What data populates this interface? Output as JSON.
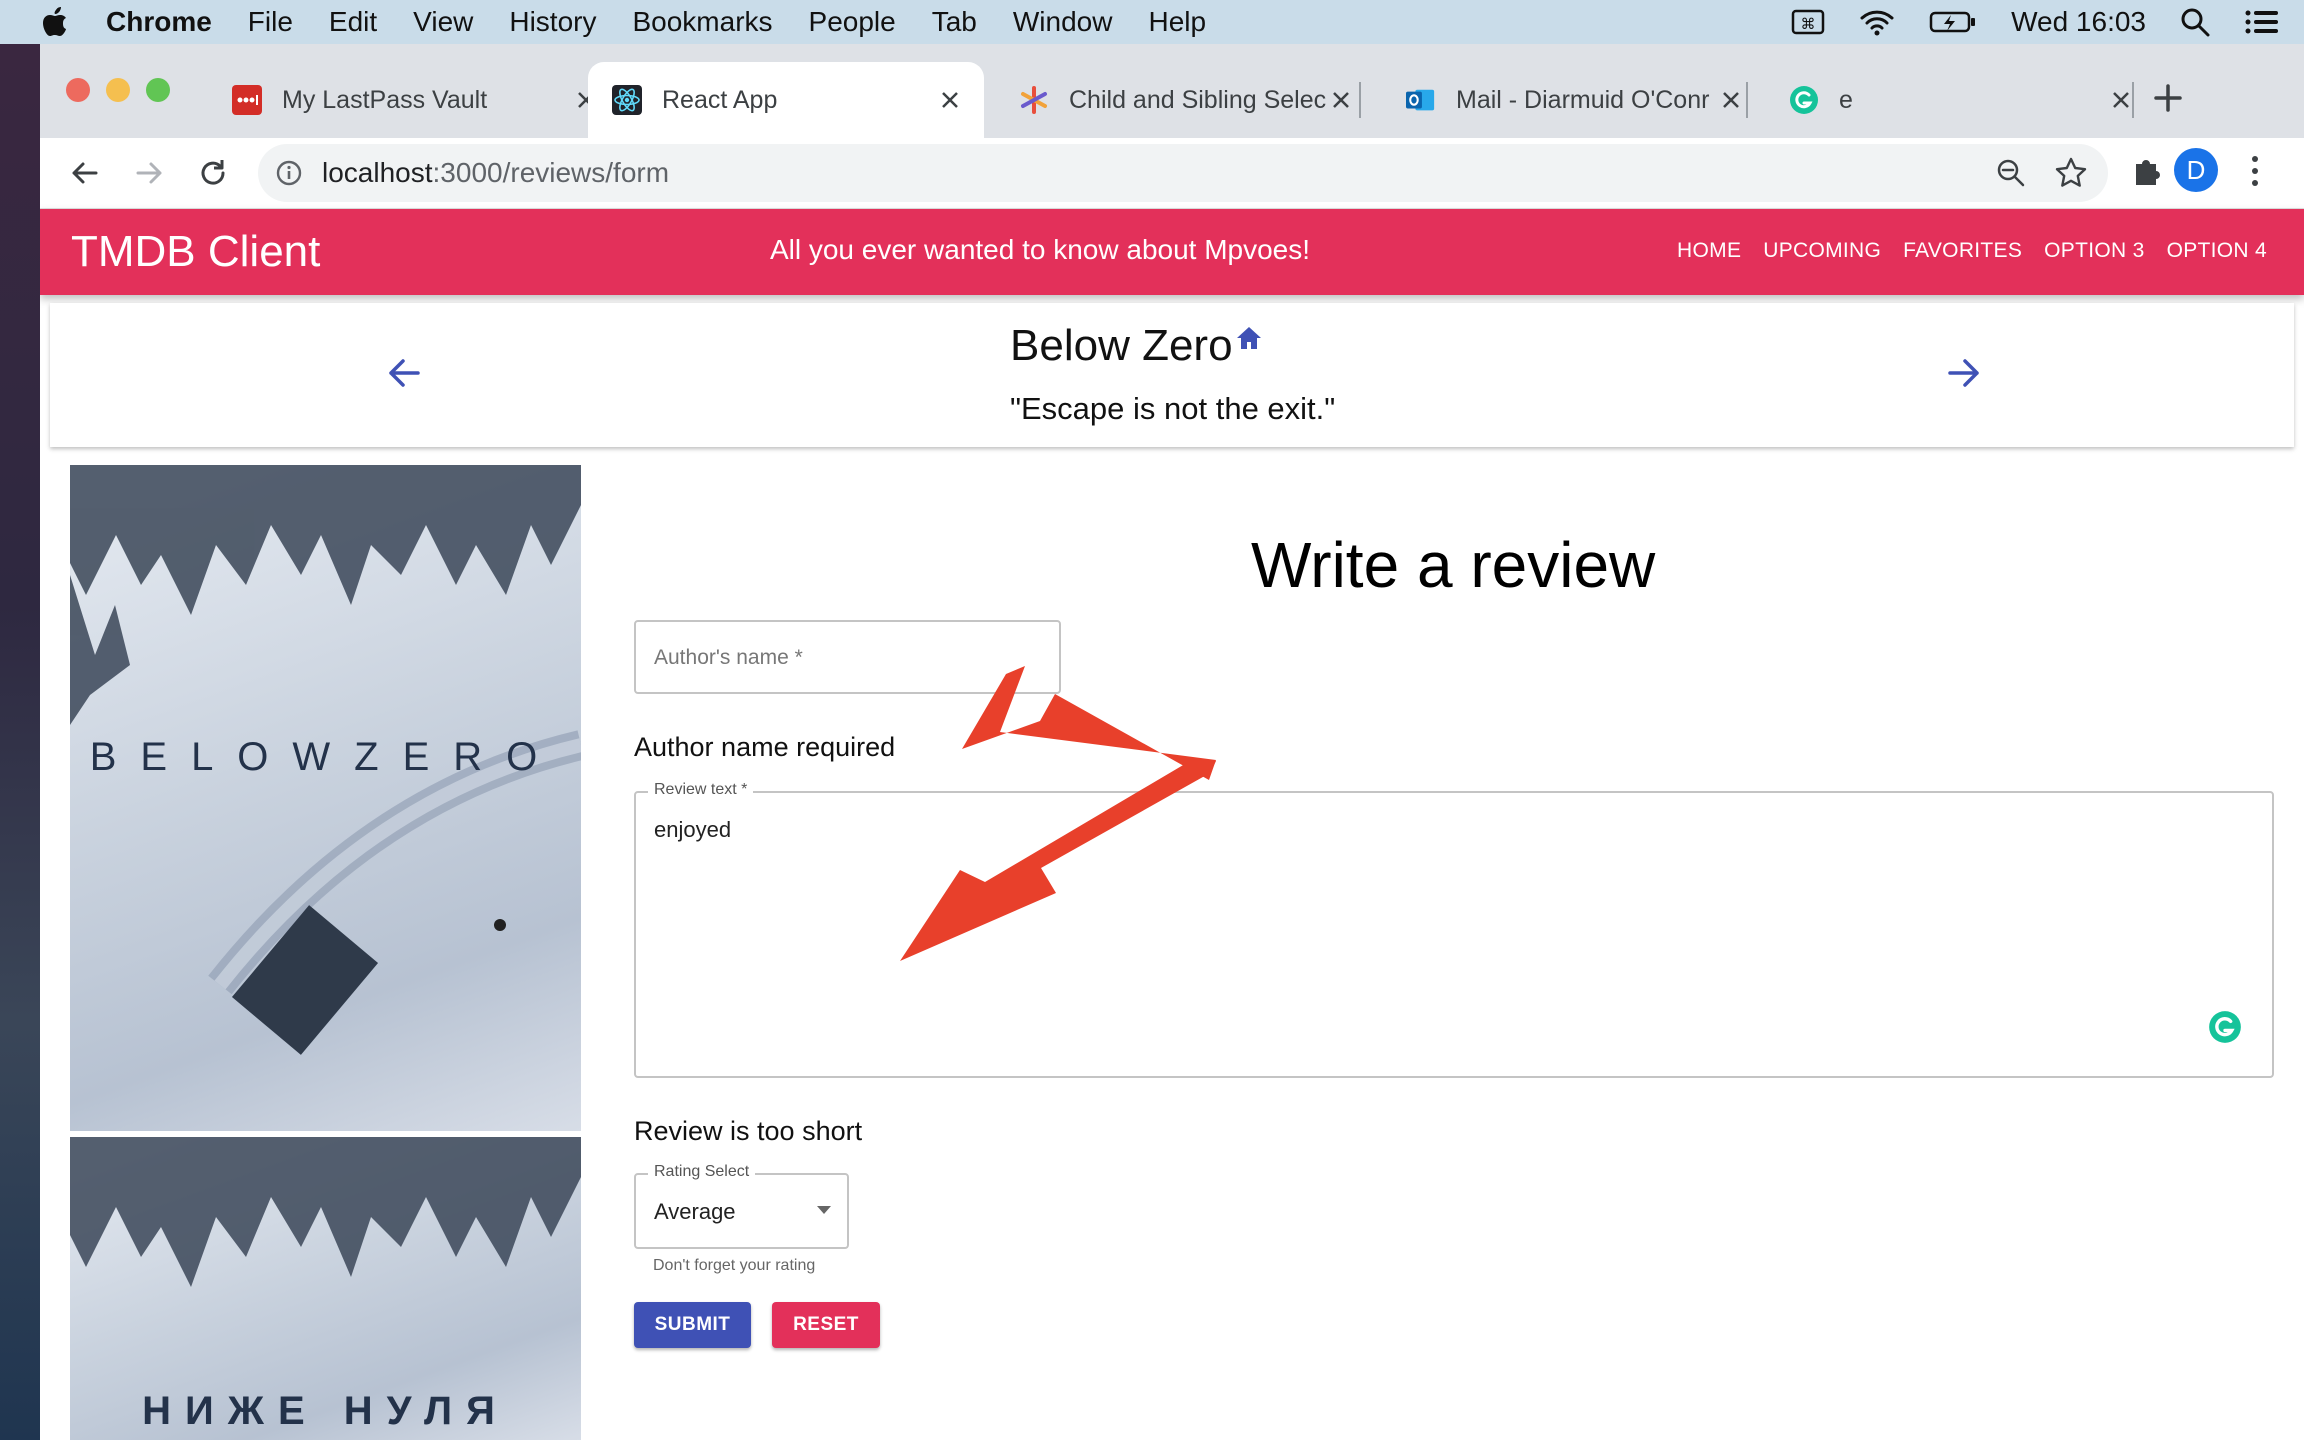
{
  "menubar": {
    "items": [
      "Chrome",
      "File",
      "Edit",
      "View",
      "History",
      "Bookmarks",
      "People",
      "Tab",
      "Window",
      "Help"
    ],
    "clock": "Wed 16:03"
  },
  "tabs": [
    {
      "title": "My LastPass Vault",
      "icon": "lastpass-icon"
    },
    {
      "title": "React App",
      "icon": "react-icon",
      "active": true
    },
    {
      "title": "Child and Sibling Selec",
      "icon": "asterisk-icon"
    },
    {
      "title": "Mail - Diarmuid O'Conr",
      "icon": "outlook-icon"
    },
    {
      "title": "e",
      "icon": "grammarly-icon"
    }
  ],
  "address": {
    "host": "localhost",
    "path": ":3000/reviews/form"
  },
  "profile_initial": "D",
  "app": {
    "brand": "TMDB Client",
    "tagline": "All you ever wanted to know about Mpvoes!",
    "nav": [
      "HOME",
      "UPCOMING",
      "FAVORITES",
      "OPTION 3",
      "OPTION 4"
    ],
    "accent_color": "#e3305a"
  },
  "movie": {
    "title": "Below Zero",
    "tagline": "\"Escape is not the exit.\"",
    "poster_title_en": "BELOWZERO",
    "poster_title_ru": "НИЖЕ НУЛЯ"
  },
  "form": {
    "heading": "Write a review",
    "author_placeholder": "Author's name",
    "author_error": "Author name required",
    "review_label": "Review text",
    "review_value": "enjoyed",
    "review_error": "Review is too short",
    "rating_label": "Rating Select",
    "rating_value": "Average",
    "rating_helper": "Don't forget your rating",
    "submit_label": "SUBMIT",
    "reset_label": "RESET",
    "submit_color": "#3f51b5",
    "reset_color": "#e3305a"
  },
  "annotation_color": "#e8402b"
}
